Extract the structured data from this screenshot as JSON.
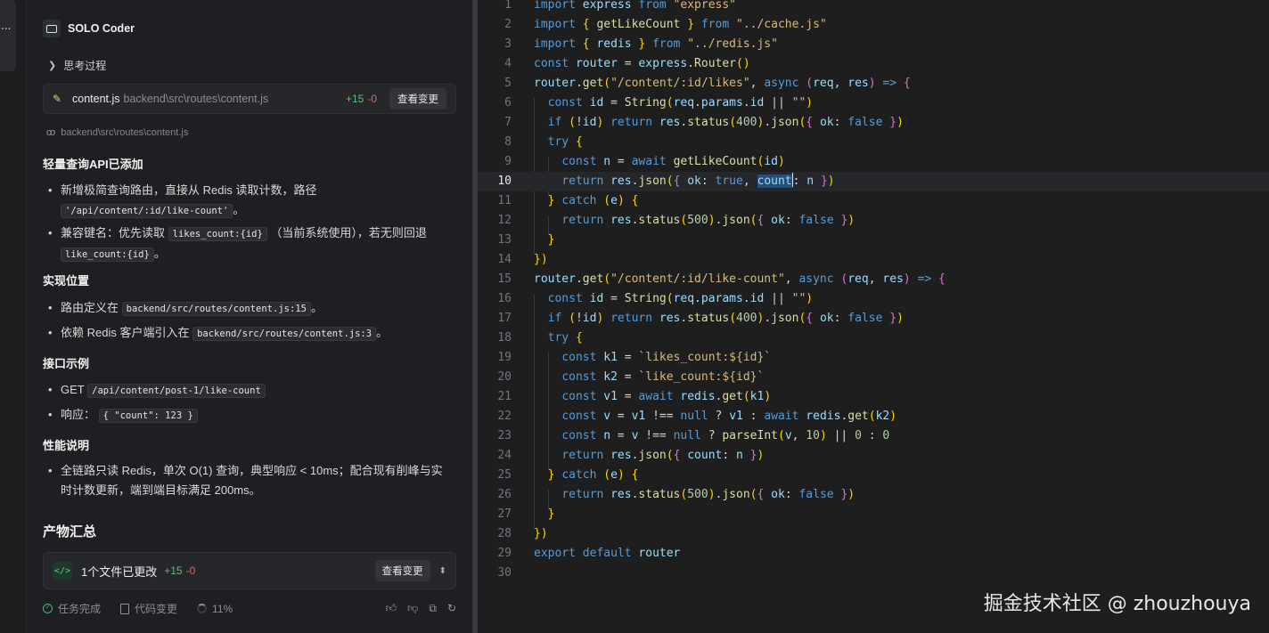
{
  "rail": {
    "tab_label": "..."
  },
  "agent": {
    "name": "SOLO Coder"
  },
  "thinking": {
    "label": "思考过程"
  },
  "file_card": {
    "file_name": "content.js",
    "file_path": "backend\\src\\routes\\content.js",
    "additions": "+15",
    "deletions": "-0",
    "view_label": "查看变更"
  },
  "read_path": "backend\\src\\routes\\content.js",
  "sections": {
    "s1_title": "轻量查询API已添加",
    "s1_b1_text": "新增极简查询路由，直接从 Redis 读取计数，路径",
    "s1_b1_code": "'/api/content/:id/like-count'",
    "s1_b1_tail": "。",
    "s1_b2_text": "兼容键名：优先读取",
    "s1_b2_code1": "likes_count:{id}",
    "s1_b2_mid": "（当前系统使用），若无则回退",
    "s1_b2_code2": "like_count:{id}",
    "s1_b2_tail": "。",
    "s2_title": "实现位置",
    "s2_b1_text": "路由定义在",
    "s2_b1_code": "backend/src/routes/content.js:15",
    "s2_b1_tail": "。",
    "s2_b2_text": "依赖 Redis 客户端引入在",
    "s2_b2_code": "backend/src/routes/content.js:3",
    "s2_b2_tail": "。",
    "s3_title": "接口示例",
    "s3_b1_text": "GET",
    "s3_b1_code": "/api/content/post-1/like-count",
    "s3_b2_text": "响应：",
    "s3_b2_code": "{ \"count\": 123 }",
    "s4_title": "性能说明",
    "s4_b1_line1": "全链路只读 Redis，单次 O(1) 查询，典型响应 < 10ms；配合现有削峰与实",
    "s4_b1_line2": "时计数更新，端到端目标满足 200ms。"
  },
  "summary": {
    "title": "产物汇总",
    "icon_text": "</>",
    "files_changed": "1个文件已更改",
    "additions": "+15",
    "deletions": "-0",
    "view_label": "查看变更"
  },
  "status_bar": {
    "task_done": "任务完成",
    "code_changes": "代码变更",
    "progress": "11%"
  },
  "icons": {
    "agent": "terminal-icon",
    "thinking": "chevron-right-icon",
    "edit": "pencil-icon",
    "read": "glasses-icon",
    "summary": "code-icon",
    "expand": "chevron-updown-icon",
    "task": "check-circle-icon",
    "changes": "document-icon",
    "progress": "progress-ring-icon",
    "thumbs_up": "thumbs-up-icon",
    "thumbs_down": "thumbs-down-icon",
    "copy": "copy-icon",
    "retry": "refresh-icon"
  },
  "colors": {
    "additions": "#5fb87a",
    "deletions": "#e0655a",
    "keyword": "#569cd6",
    "string": "#d7ba7d",
    "function": "#dcdcaa",
    "variable": "#9cdcfe",
    "number": "#b5cea8"
  },
  "editor": {
    "active_line": 10,
    "line_numbers": [
      "1",
      "2",
      "3",
      "4",
      "5",
      "6",
      "7",
      "8",
      "9",
      "10",
      "11",
      "12",
      "13",
      "14",
      "15",
      "16",
      "17",
      "18",
      "19",
      "20",
      "21",
      "22",
      "23",
      "24",
      "25",
      "26",
      "27",
      "28",
      "29",
      "30"
    ],
    "lines": [
      "import express from \"express\"",
      "import { getLikeCount } from \"../cache.js\"",
      "import { redis } from \"../redis.js\"",
      "const router = express.Router()",
      "router.get(\"/content/:id/likes\", async (req, res) => {",
      "  const id = String(req.params.id || \"\")",
      "  if (!id) return res.status(400).json({ ok: false })",
      "  try {",
      "    const n = await getLikeCount(id)",
      "    return res.json({ ok: true, count: n })",
      "  } catch (e) {",
      "    return res.status(500).json({ ok: false })",
      "  }",
      "})",
      "router.get(\"/content/:id/like-count\", async (req, res) => {",
      "  const id = String(req.params.id || \"\")",
      "  if (!id) return res.status(400).json({ ok: false })",
      "  try {",
      "    const k1 = `likes_count:${id}`",
      "    const k2 = `like_count:${id}`",
      "    const v1 = await redis.get(k1)",
      "    const v = v1 !== null ? v1 : await redis.get(k2)",
      "    const n = v !== null ? parseInt(v, 10) || 0 : 0",
      "    return res.json({ count: n })",
      "  } catch (e) {",
      "    return res.status(500).json({ ok: false })",
      "  }",
      "})",
      "export default router",
      ""
    ]
  },
  "watermark": "掘金技术社区 @ zhouzhouya"
}
